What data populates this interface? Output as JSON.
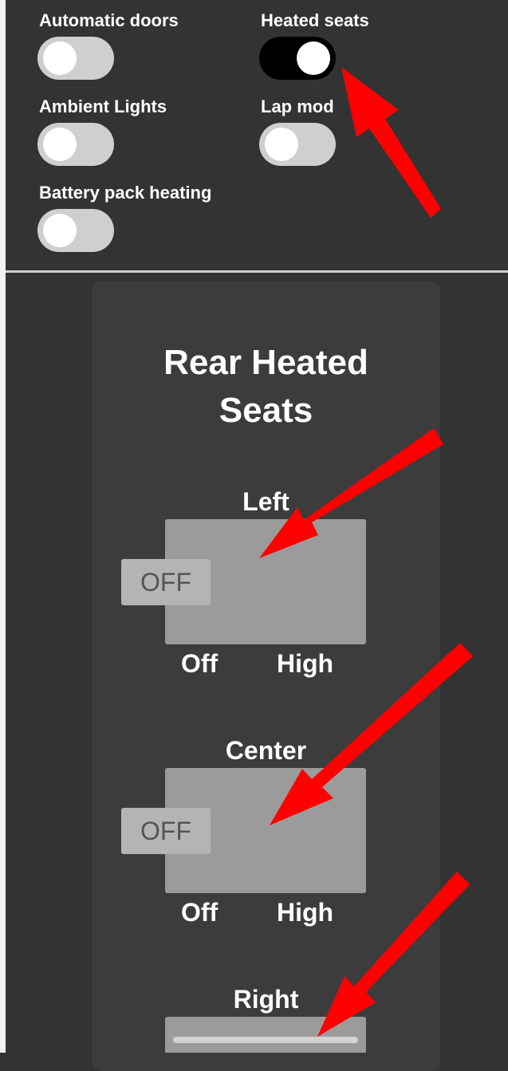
{
  "toggles": {
    "automatic_doors": {
      "label": "Automatic doors",
      "on": false
    },
    "heated_seats": {
      "label": "Heated seats",
      "on": true
    },
    "ambient_lights": {
      "label": "Ambient Lights",
      "on": false
    },
    "lap_mode": {
      "label": "Lap mod",
      "on": false
    },
    "battery_pack_heating": {
      "label": "Battery pack heating",
      "on": false
    }
  },
  "rear": {
    "title_line1": "Rear Heated",
    "title_line2": "Seats",
    "left": {
      "label": "Left",
      "state": "OFF",
      "min_label": "Off",
      "max_label": "High"
    },
    "center": {
      "label": "Center",
      "state": "OFF",
      "min_label": "Off",
      "max_label": "High"
    },
    "right": {
      "label": "Right"
    }
  },
  "colors": {
    "background": "#333333",
    "panel": "#3c3c3c",
    "toggle_off": "#cfcfcf",
    "toggle_on": "#000000",
    "arrow": "#ff0000"
  }
}
